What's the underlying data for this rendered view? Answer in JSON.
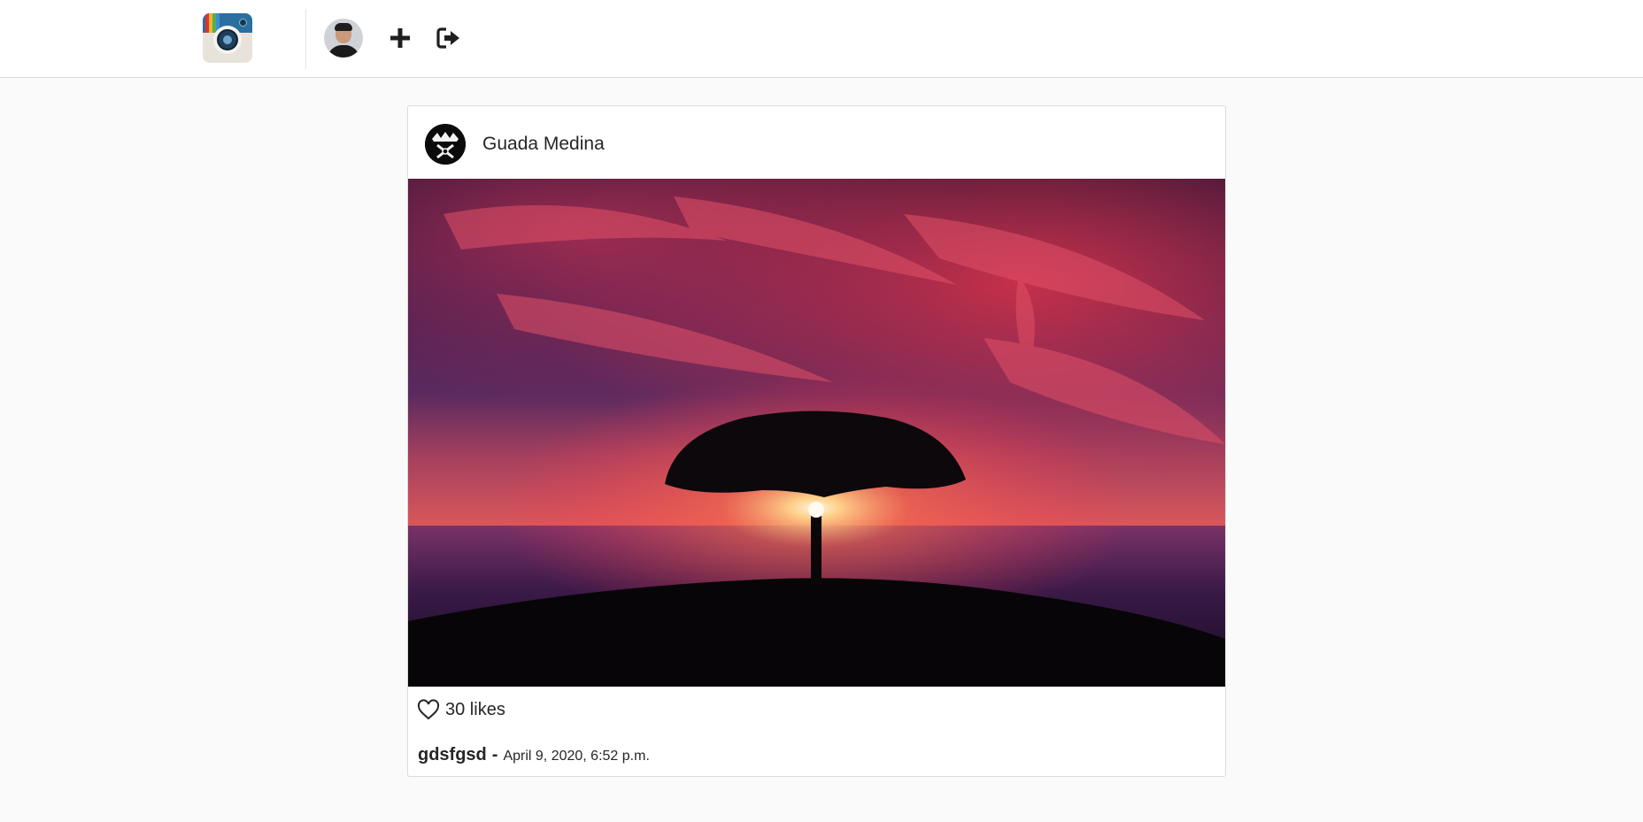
{
  "header": {
    "logo_icon": "camera-logo-icon",
    "new_post_icon": "plus-icon",
    "logout_icon": "sign-out-icon"
  },
  "post": {
    "author": "Guada Medina",
    "likes_text": "30 likes",
    "caption_user": "gdsfgsd",
    "caption_separator": "-",
    "timestamp": "April 9, 2020, 6:52 p.m.",
    "like_icon": "heart-outline-icon"
  },
  "colors": {
    "background": "#fafafa",
    "card": "#ffffff",
    "border": "#dbdbdb",
    "text": "#262626"
  }
}
